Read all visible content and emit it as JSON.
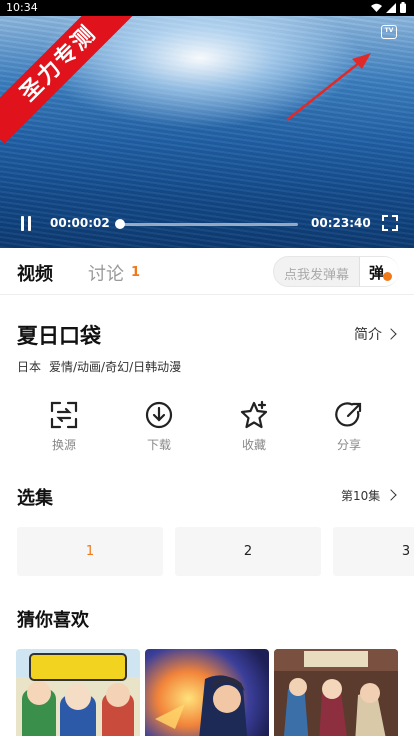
{
  "status_bar": {
    "time": "10:34"
  },
  "video": {
    "watermark": "圣力专测",
    "tv_label": "TV",
    "current_time": "00:00:02",
    "duration": "00:23:40",
    "progress": 0.0014
  },
  "tabs": {
    "video_label": "视频",
    "discussion_label": "讨论",
    "discussion_count": "1",
    "danmu_placeholder": "点我发弹幕",
    "danmu_button": "弹"
  },
  "show": {
    "title": "夏日口袋",
    "intro_label": "简介",
    "meta": [
      "日本",
      "爱情/动画/奇幻/日韩动漫"
    ]
  },
  "actions": [
    {
      "label": "换源",
      "icon": "swap-source-icon"
    },
    {
      "label": "下载",
      "icon": "download-icon"
    },
    {
      "label": "收藏",
      "icon": "favorite-star-icon"
    },
    {
      "label": "分享",
      "icon": "share-icon"
    }
  ],
  "episodes": {
    "section_title": "选集",
    "more_label": "第10集",
    "items": [
      "1",
      "2",
      "3"
    ],
    "active_index": 0
  },
  "recommend": {
    "section_title": "猜你喜欢"
  },
  "colors": {
    "accent": "#f07a1a",
    "ribbon": "#e0131c",
    "arrow": "#e02a2a"
  }
}
